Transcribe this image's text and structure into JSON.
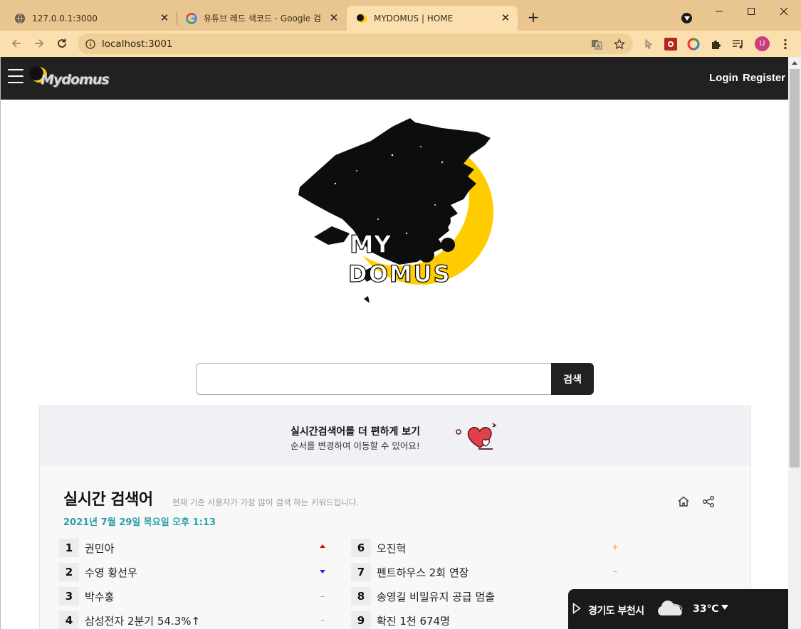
{
  "browser": {
    "tabs": [
      {
        "title": "127.0.0.1:3000",
        "icon": "globe-icon",
        "active": false
      },
      {
        "title": "유튜브 레드 색코드 - Google 검",
        "icon": "google-icon",
        "active": false
      },
      {
        "title": "MYDOMUS | HOME",
        "icon": "mydomus-icon",
        "active": true
      }
    ],
    "address": "localhost:3001",
    "profile_initials": "IJ"
  },
  "site": {
    "brand": "Mydomus",
    "nav": {
      "login": "Login",
      "register": "Register"
    },
    "hero_logo_text": [
      "MY",
      "DOMUS"
    ]
  },
  "search": {
    "value": "",
    "button": "검색"
  },
  "banner": {
    "title": "실시간검색어를 더 편하게 보기",
    "subtitle": "순서를 변경하여 이동할 수 있어요!"
  },
  "realtime": {
    "title": "실시간 검색어",
    "description": "현재 기준 사용자가 가장 많이 검색 하는 키워드입니다.",
    "datetime": "2021년 7월 29일 목요일 오후 1:13",
    "left": [
      {
        "rank": "1",
        "keyword": "권민아",
        "trend": "up"
      },
      {
        "rank": "2",
        "keyword": "수영 황선우",
        "trend": "down"
      },
      {
        "rank": "3",
        "keyword": "박수홍",
        "trend": "same"
      },
      {
        "rank": "4",
        "keyword": "삼성전자 2분기 54.3%↑",
        "trend": "same"
      }
    ],
    "right": [
      {
        "rank": "6",
        "keyword": "오진혁",
        "trend": "new"
      },
      {
        "rank": "7",
        "keyword": "펜트하우스 2회 연장",
        "trend": "same"
      },
      {
        "rank": "8",
        "keyword": "송영길 비밀유지 공급 멈출",
        "trend": "same"
      },
      {
        "rank": "9",
        "keyword": "확진 1천 674명",
        "trend": "same"
      }
    ]
  },
  "weather": {
    "location": "경기도 부천시",
    "temperature": "33℃",
    "icon": "cloud-icon"
  },
  "colors": {
    "nav_bg": "#212121",
    "accent_teal": "#2aa0a4",
    "moon_yellow": "#ffcc00",
    "browser_tab": "#e9c58f"
  }
}
